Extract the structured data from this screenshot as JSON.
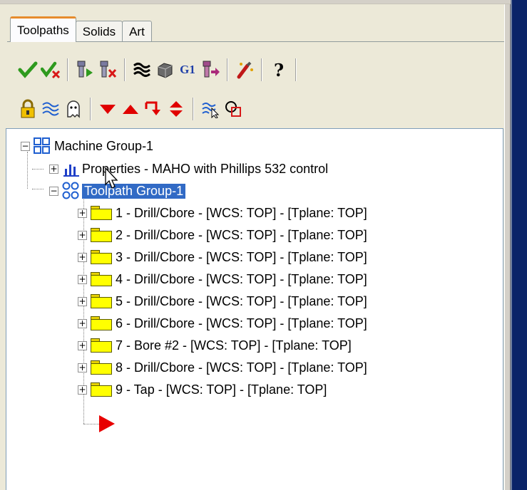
{
  "tabs": [
    {
      "label": "Toolpaths",
      "active": true
    },
    {
      "label": "Solids",
      "active": false
    },
    {
      "label": "Art",
      "active": false
    }
  ],
  "toolbar1": {
    "g1_label": "G1",
    "help_label": "?"
  },
  "tree": {
    "machine_group": "Machine Group-1",
    "properties": "Properties - MAHO with Phillips 532 control",
    "toolpath_group": "Toolpath Group-1",
    "operations": [
      "1 - Drill/Cbore - [WCS: TOP] - [Tplane: TOP]",
      "2 - Drill/Cbore - [WCS: TOP] - [Tplane: TOP]",
      "3 - Drill/Cbore - [WCS: TOP] - [Tplane: TOP]",
      "4 - Drill/Cbore - [WCS: TOP] - [Tplane: TOP]",
      "5 - Drill/Cbore - [WCS: TOP] - [Tplane: TOP]",
      "6 - Drill/Cbore - [WCS: TOP] - [Tplane: TOP]",
      "7 - Bore #2 - [WCS: TOP] - [Tplane: TOP]",
      "8 - Drill/Cbore - [WCS: TOP] - [Tplane: TOP]",
      "9 - Tap - [WCS: TOP] - [Tplane: TOP]"
    ],
    "expand_symbol": "+",
    "collapse_symbol": "−"
  },
  "colors": {
    "selection": "#316ac5",
    "folder": "#ffff00",
    "insert_arrow": "#e00000"
  }
}
